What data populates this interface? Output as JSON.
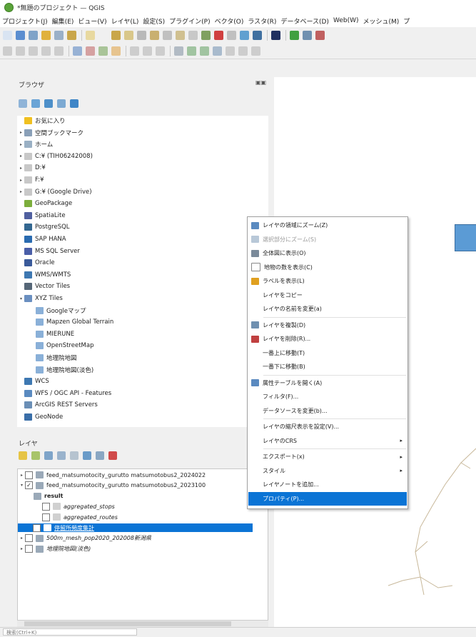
{
  "window": {
    "title": "*無題のプロジェクト — QGIS"
  },
  "menubar": [
    "プロジェクト(J)",
    "編集(E)",
    "ビュー(V)",
    "レイヤ(L)",
    "設定(S)",
    "プラグイン(P)",
    "ベクタ(O)",
    "ラスタ(R)",
    "データベース(D)",
    "Web(W)",
    "メッシュ(M)",
    "プ"
  ],
  "browser_panel": {
    "title": "ブラウザ",
    "items": [
      {
        "label": "お気に入り",
        "icon": "star-icon",
        "expand": ""
      },
      {
        "label": "空間ブックマーク",
        "icon": "bookmark-icon",
        "expand": "▸"
      },
      {
        "label": "ホーム",
        "icon": "home-folder-icon",
        "expand": "▸"
      },
      {
        "label": "C:¥ (TIH06242008)",
        "icon": "drive-icon",
        "expand": "▸"
      },
      {
        "label": "D:¥",
        "icon": "drive-icon",
        "expand": "▸"
      },
      {
        "label": "F:¥",
        "icon": "drive-icon",
        "expand": "▸"
      },
      {
        "label": "G:¥ (Google Drive)",
        "icon": "drive-icon",
        "expand": "▸"
      },
      {
        "label": "GeoPackage",
        "icon": "geopackage-icon",
        "expand": ""
      },
      {
        "label": "SpatiaLite",
        "icon": "spatialite-icon",
        "expand": ""
      },
      {
        "label": "PostgreSQL",
        "icon": "postgresql-icon",
        "expand": ""
      },
      {
        "label": "SAP HANA",
        "icon": "sap-hana-icon",
        "expand": ""
      },
      {
        "label": "MS SQL Server",
        "icon": "mssql-icon",
        "expand": ""
      },
      {
        "label": "Oracle",
        "icon": "oracle-icon",
        "expand": ""
      },
      {
        "label": "WMS/WMTS",
        "icon": "wms-icon",
        "expand": ""
      },
      {
        "label": "Vector Tiles",
        "icon": "vector-tiles-icon",
        "expand": ""
      },
      {
        "label": "XYZ Tiles",
        "icon": "xyz-tiles-icon",
        "expand": "▾"
      },
      {
        "label": "Googleマップ",
        "icon": "tile-grid-icon",
        "expand": "",
        "indent": 1
      },
      {
        "label": "Mapzen Global Terrain",
        "icon": "tile-grid-icon",
        "expand": "",
        "indent": 1
      },
      {
        "label": "MIERUNE",
        "icon": "tile-grid-icon",
        "expand": "",
        "indent": 1
      },
      {
        "label": "OpenStreetMap",
        "icon": "tile-grid-icon",
        "expand": "",
        "indent": 1
      },
      {
        "label": "地理院地図",
        "icon": "tile-grid-icon",
        "expand": "",
        "indent": 1
      },
      {
        "label": "地理院地図(淡色)",
        "icon": "tile-grid-icon",
        "expand": "",
        "indent": 1
      },
      {
        "label": "WCS",
        "icon": "wcs-icon",
        "expand": ""
      },
      {
        "label": "WFS / OGC API - Features",
        "icon": "wfs-icon",
        "expand": ""
      },
      {
        "label": "ArcGIS REST Servers",
        "icon": "arcgis-icon",
        "expand": ""
      },
      {
        "label": "GeoNode",
        "icon": "geonode-icon",
        "expand": ""
      }
    ]
  },
  "layers_panel": {
    "title": "レイヤ",
    "items": [
      {
        "label": "feed_matsumotocity_gurutto matsumotobus2_2024022",
        "checked": false,
        "expand": "▸",
        "indent": 0,
        "italic": false
      },
      {
        "label": "feed_matsumotocity_gurutto matsumotobus2_2023100",
        "checked": true,
        "expand": "▾",
        "indent": 0,
        "italic": false
      },
      {
        "label": "result",
        "checked": null,
        "expand": "",
        "indent": 1,
        "italic": false,
        "bold": true
      },
      {
        "label": "aggregated_stops",
        "checked": false,
        "expand": "",
        "indent": 2,
        "italic": true
      },
      {
        "label": "aggregated_routes",
        "checked": false,
        "expand": "",
        "indent": 2,
        "italic": true
      },
      {
        "label": "停留所頻度集計",
        "checked": true,
        "expand": "",
        "indent": 0,
        "italic": false,
        "selected": true
      },
      {
        "label": "500m_mesh_pop2020_202008新潟県",
        "checked": false,
        "expand": "▸",
        "indent": 0,
        "italic": true
      },
      {
        "label": "地理院地図(淡色)",
        "checked": false,
        "expand": "▸",
        "indent": 0,
        "italic": true
      }
    ]
  },
  "context_menu": {
    "items": [
      {
        "label": "レイヤの領域にズーム(Z)",
        "icon": "zoom-layer-icon",
        "disabled": false
      },
      {
        "label": "選択部分にズーム(S)",
        "icon": "zoom-selection-icon",
        "disabled": true
      },
      {
        "label": "全体図に表示(O)",
        "icon": "overview-icon",
        "disabled": false
      },
      {
        "label": "地物の数を表示(C)",
        "icon": "feature-count-icon",
        "disabled": false
      },
      {
        "label": "ラベルを表示(L)",
        "icon": "label-icon",
        "disabled": false
      },
      {
        "label": "レイヤをコピー",
        "icon": "",
        "disabled": false
      },
      {
        "label": "レイヤの名前を変更(a)",
        "icon": "",
        "disabled": false
      },
      {
        "label": "レイヤを複製(D)",
        "icon": "duplicate-icon",
        "disabled": false,
        "sep_before": true
      },
      {
        "label": "レイヤを削除(R)...",
        "icon": "remove-layer-icon",
        "disabled": false
      },
      {
        "label": "一番上に移動(T)",
        "icon": "",
        "disabled": false
      },
      {
        "label": "一番下に移動(B)",
        "icon": "",
        "disabled": false
      },
      {
        "label": "属性テーブルを開く(A)",
        "icon": "attribute-table-icon",
        "disabled": false,
        "sep_before": true
      },
      {
        "label": "フィルタ(F)...",
        "icon": "",
        "disabled": false
      },
      {
        "label": "データソースを変更(b)...",
        "icon": "",
        "disabled": false
      },
      {
        "label": "レイヤの縮尺表示を設定(V)...",
        "icon": "",
        "disabled": false,
        "sep_before": true
      },
      {
        "label": "レイヤのCRS",
        "icon": "",
        "disabled": false,
        "submenu": true
      },
      {
        "label": "エクスポート(x)",
        "icon": "",
        "disabled": false,
        "submenu": true,
        "sep_before": true
      },
      {
        "label": "スタイル",
        "icon": "",
        "disabled": false,
        "submenu": true
      },
      {
        "label": "レイヤノートを追加...",
        "icon": "",
        "disabled": false
      },
      {
        "label": "プロパティ(P)...",
        "icon": "",
        "disabled": false,
        "highlighted": true
      }
    ]
  },
  "statusbar": {
    "search_placeholder": "検索(Ctrl+K)"
  },
  "colors": {
    "selection": "#0b74d5",
    "annotation_box": "#5b9bd5",
    "canvas_lines": "#c8b89a"
  }
}
